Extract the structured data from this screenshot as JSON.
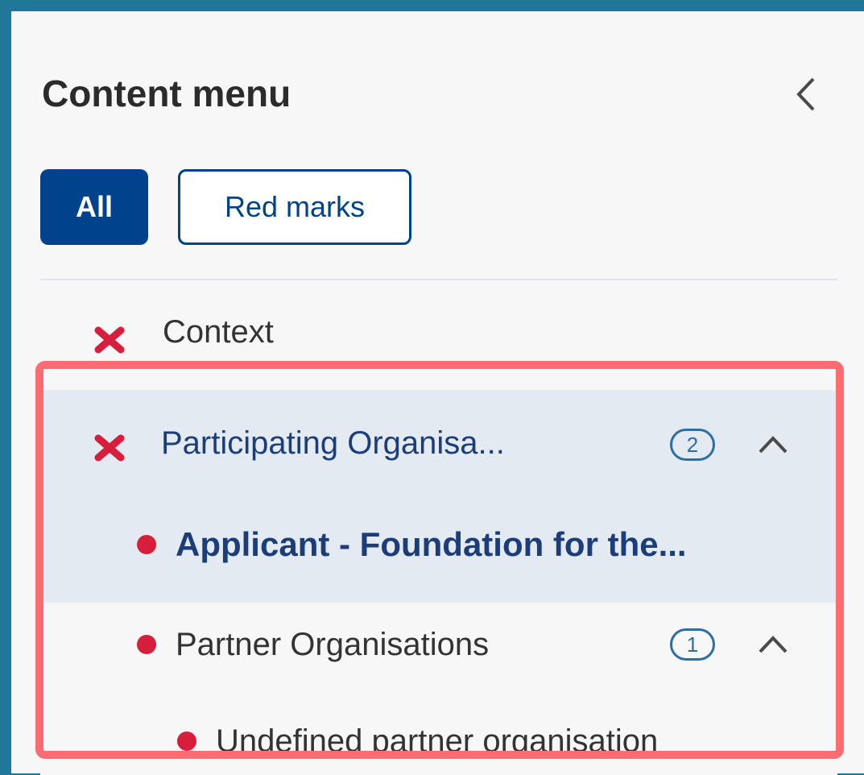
{
  "panel": {
    "title": "Content menu",
    "collapse_icon": "chevron-left-icon"
  },
  "filters": {
    "all_label": "All",
    "red_marks_label": "Red marks"
  },
  "menu": {
    "items": [
      {
        "label": "Context",
        "status_icon": "error-x-icon"
      },
      {
        "label": "Participating Organisa...",
        "status_icon": "error-x-icon",
        "count": "2",
        "expanded": true,
        "selected": true
      },
      {
        "label": "Applicant - Foundation for the...",
        "status_icon": "red-dot-icon",
        "selected": true
      },
      {
        "label": "Partner Organisations",
        "status_icon": "red-dot-icon",
        "count": "1",
        "expanded": true
      },
      {
        "label": "Undefined partner organisation",
        "status_icon": "red-dot-icon"
      }
    ]
  },
  "colors": {
    "frame": "#1f7898",
    "primary": "#00428b",
    "error": "#d81e3d",
    "highlight": "#ff6b73",
    "selected_bg": "#e4eaf2"
  }
}
